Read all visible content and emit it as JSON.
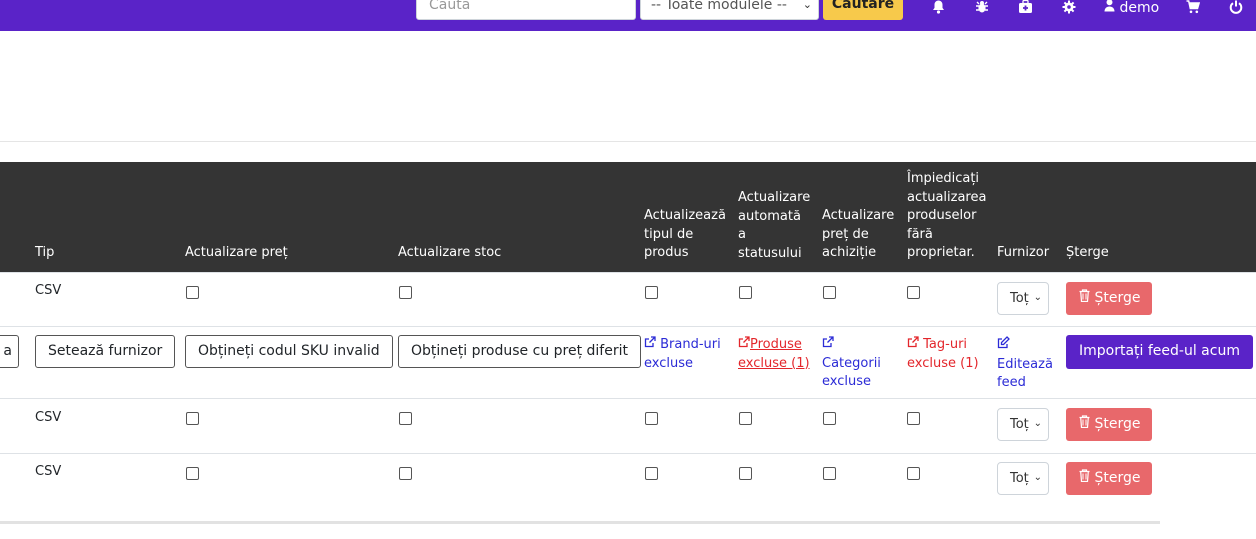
{
  "topbar": {
    "search_placeholder": "Caută",
    "module_select": "-- Toate modulele --",
    "search_button": "Căutare",
    "user_label": "demo"
  },
  "table": {
    "headers": {
      "tip": "Tip",
      "price": "Actualizare preț",
      "stock": "Actualizare stoc",
      "type_line1": "Actualizează",
      "type_line2": "tipul de",
      "type_line3": "produs",
      "auto_line1": "Actualizare",
      "auto_line2": "automată",
      "auto_line3": "a",
      "auto_line4": "statusului",
      "purchase_line1": "Actualizare",
      "purchase_line2": "preț de",
      "purchase_line3": "achiziție",
      "prevent_line1": "Împiedicați",
      "prevent_line2": "actualizarea",
      "prevent_line3": "produselor",
      "prevent_line4": "fără",
      "prevent_line5": "proprietar.",
      "supplier": "Furnizor",
      "delete": "Șterge"
    },
    "rows": [
      {
        "type": "CSV",
        "supplier": "Toț",
        "delete": "Șterge"
      },
      {
        "type": "CSV",
        "supplier": "Toț",
        "delete": "Șterge"
      },
      {
        "type": "CSV",
        "supplier": "Toț",
        "delete": "Șterge"
      }
    ],
    "action_row": {
      "partial_button": "a",
      "set_supplier": "Setează furnizor",
      "invalid_sku": "Obțineți codul SKU invalid",
      "diff_price": "Obțineți produse cu preț diferit",
      "brands_line1": "Brand-uri",
      "brands_line2": "excluse",
      "products_line1": "Produse",
      "products_line2": "excluse (1)",
      "categories_line1": "Categorii",
      "categories_line2": "excluse",
      "tags_line1": "Tag-uri",
      "tags_line2": "excluse (1)",
      "edit_line1": "Editează",
      "edit_line2": "feed",
      "import_button": "Importați feed-ul acum"
    }
  },
  "colors": {
    "topbar": "#5a23c8",
    "search_button": "#f7c94b",
    "header_bg": "#343434",
    "delete_button": "#e8686b",
    "primary_button": "#5a23c8",
    "link_blue": "#2b2bd6",
    "link_red": "#e3262b"
  },
  "icons": [
    "bell-icon",
    "bug-icon",
    "medkit-icon",
    "gear-icon",
    "user-icon",
    "cart-icon",
    "power-icon",
    "trash-icon",
    "external-link-icon",
    "edit-icon"
  ]
}
